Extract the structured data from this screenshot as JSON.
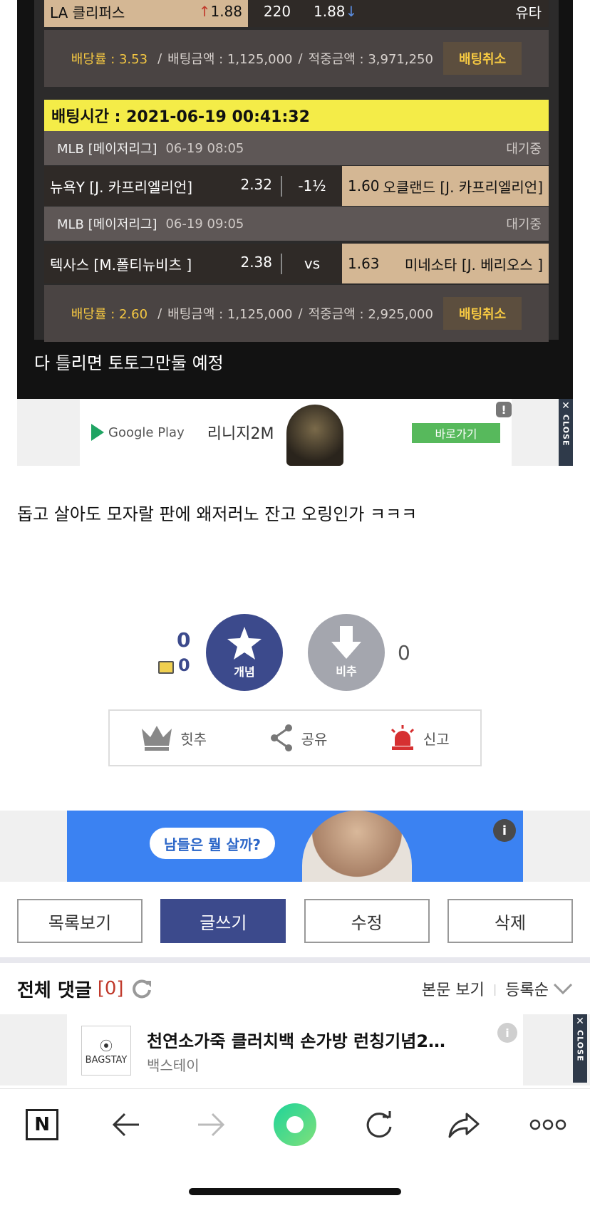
{
  "bet": {
    "top_row": {
      "team": "LA 클리퍼스",
      "odds_left": "1.88",
      "mid": "220",
      "odds_right": "1.88",
      "away": "유타"
    },
    "summary1": {
      "odds": "배당률 : 3.53",
      "amount": "배팅금액 : 1,125,000",
      "win": "적중금액 : 3,971,250",
      "cancel": "배팅취소",
      "sep": "/"
    },
    "time": "배팅시간 : 2021-06-19 00:41:32",
    "game1": {
      "league": "MLB [메이저리그]",
      "date": "06-19 08:05",
      "status": "대기중",
      "home": "뉴욕Y [J. 카프리엘리언]",
      "home_odds": "2.32",
      "mid": "-1½",
      "away_odds": "1.60",
      "away": "오클랜드 [J. 카프리엘리언]"
    },
    "game2": {
      "league": "MLB [메이저리그]",
      "date": "06-19 09:05",
      "status": "대기중",
      "home": "텍사스 [M.폴티뉴비츠 ]",
      "home_odds": "2.38",
      "mid": "vs",
      "away_odds": "1.63",
      "away": "미네소타 [J. 베리오스 ]"
    },
    "summary2": {
      "odds": "배당률 : 2.60",
      "amount": "배팅금액 : 1,125,000",
      "win": "적중금액 : 2,925,000",
      "cancel": "배팅취소",
      "sep": "/"
    },
    "caption": "다 틀리면 토토그만둘 예정"
  },
  "ad1": {
    "store": "Google Play",
    "title": "리니지2M",
    "button": "바로가기",
    "info": "!",
    "close_x": "✕",
    "close": "CLOSE"
  },
  "post": {
    "text": "돕고 살아도 모자랄 판에 왜저러노 잔고 오링인가 ㅋㅋㅋ"
  },
  "vote": {
    "up_count": "0",
    "up_sub_count": "0",
    "up_label": "개념",
    "down_label": "비추",
    "down_count": "0"
  },
  "actions": {
    "hit": "힛추",
    "share": "공유",
    "report": "신고"
  },
  "ad2": {
    "bubble": "남들은 뭘 살까?",
    "info": "i"
  },
  "buttons": {
    "list": "목록보기",
    "write": "글쓰기",
    "edit": "수정",
    "delete": "삭제"
  },
  "comments": {
    "title": "전체 댓글",
    "count": "[0]",
    "view_body": "본문 보기",
    "sort": "등록순",
    "sep": "|"
  },
  "ad3": {
    "logo": "BAGSTAY",
    "title": "천연소가죽 클러치백 손가방 런칭기념2…",
    "sub": "백스테이",
    "info": "i",
    "close_x": "✕",
    "close": "CLOSE"
  },
  "toolbar": {
    "n": "N"
  }
}
